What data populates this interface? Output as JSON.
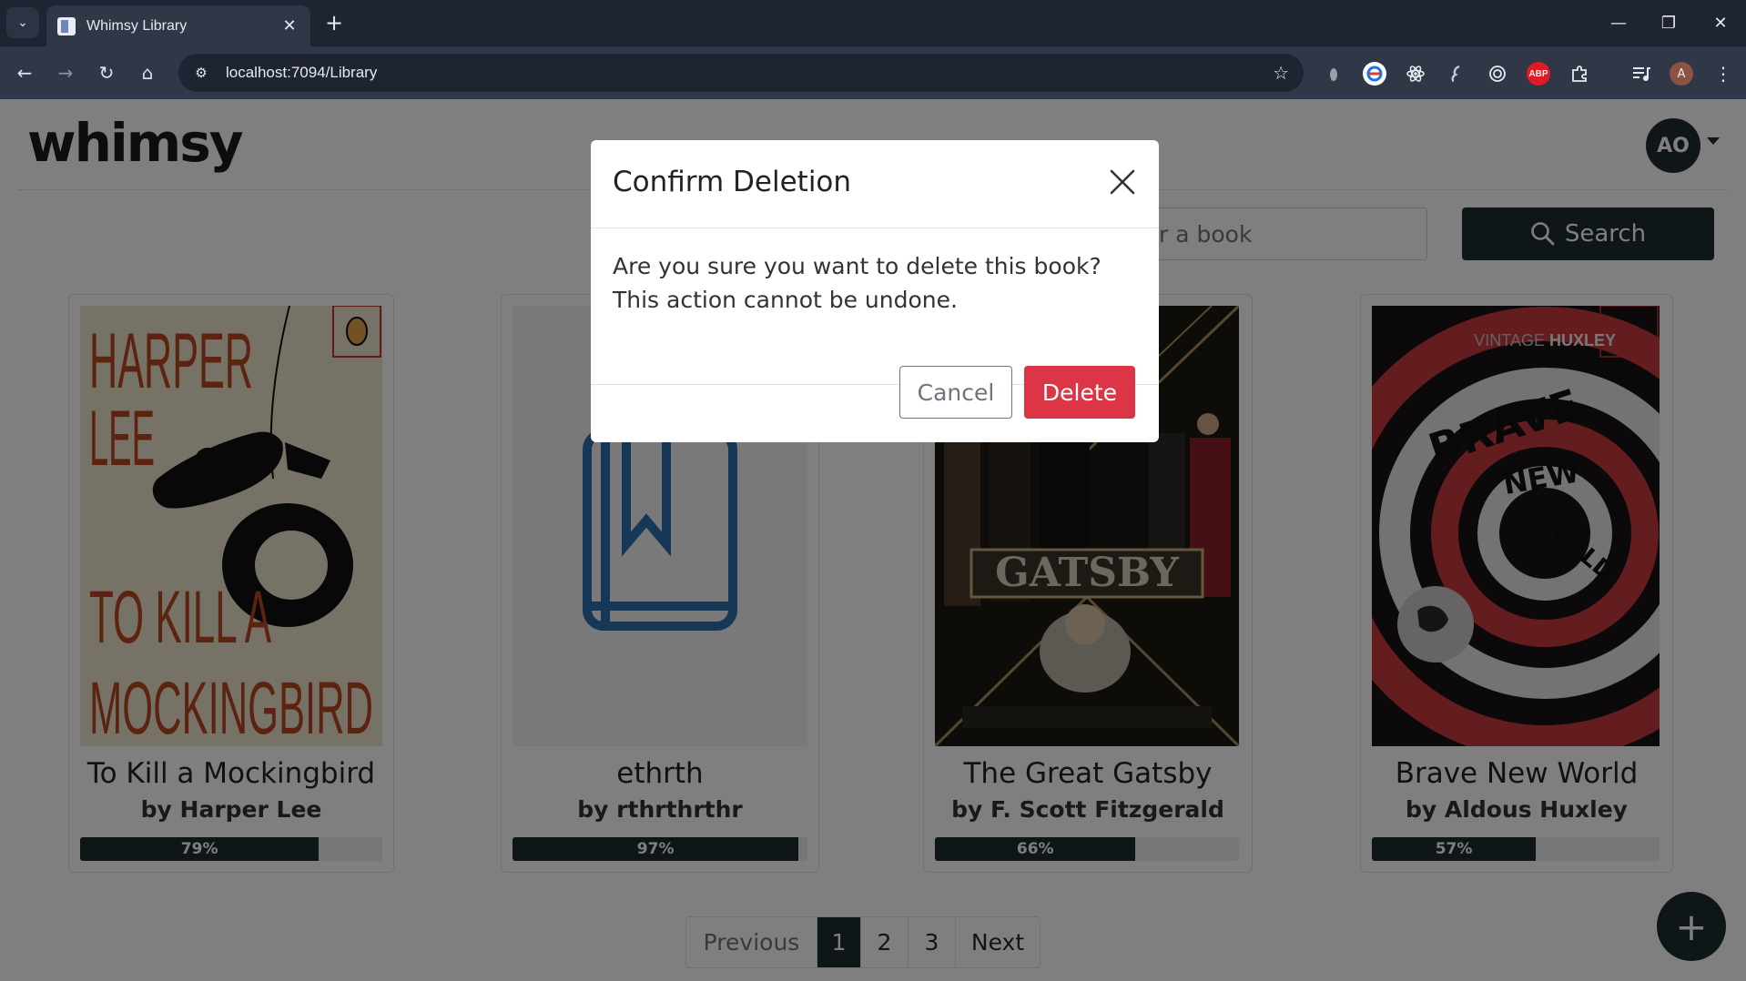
{
  "browser": {
    "tab_title": "Whimsy Library",
    "url": "localhost:7094/Library",
    "profile_initial": "A",
    "ext_abp": "ABP"
  },
  "header": {
    "logo": "whimsy",
    "avatar_initials": "AO"
  },
  "search": {
    "placeholder": "Search for a book",
    "visible_placeholder": "r a book",
    "button_label": "Search"
  },
  "books": [
    {
      "title": "To Kill a Mockingbird",
      "author": "by Harper Lee",
      "progress": 79,
      "progress_label": "79%",
      "cover_text_top": "HARPER LEE",
      "cover_text_bottom": "TO KILL A MOCKINGBIRD"
    },
    {
      "title": "ethrth",
      "author": "by rthrthrthr",
      "progress": 97,
      "progress_label": "97%"
    },
    {
      "title": "The Great Gatsby",
      "author": "by F. Scott Fitzgerald",
      "progress": 66,
      "progress_label": "66%",
      "cover_text": "GATSBY"
    },
    {
      "title": "Brave New World",
      "author": "by Aldous Huxley",
      "progress": 57,
      "progress_label": "57%",
      "cover_brand": "VINTAGE HUXLEY",
      "cover_words": [
        "BRAVE",
        "NEW",
        "WORLD"
      ]
    }
  ],
  "pagination": {
    "previous": "Previous",
    "pages": [
      "1",
      "2",
      "3"
    ],
    "next": "Next",
    "current": "1"
  },
  "fab_label": "+",
  "modal": {
    "title": "Confirm Deletion",
    "body_line1": "Are you sure you want to delete this book?",
    "body_line2": "This action cannot be undone.",
    "cancel_label": "Cancel",
    "delete_label": "Delete"
  },
  "colors": {
    "brand_dark": "#1e2c2f",
    "danger": "#dc3545",
    "chrome_dark": "#1e2431",
    "chrome_toolbar": "#303746"
  }
}
